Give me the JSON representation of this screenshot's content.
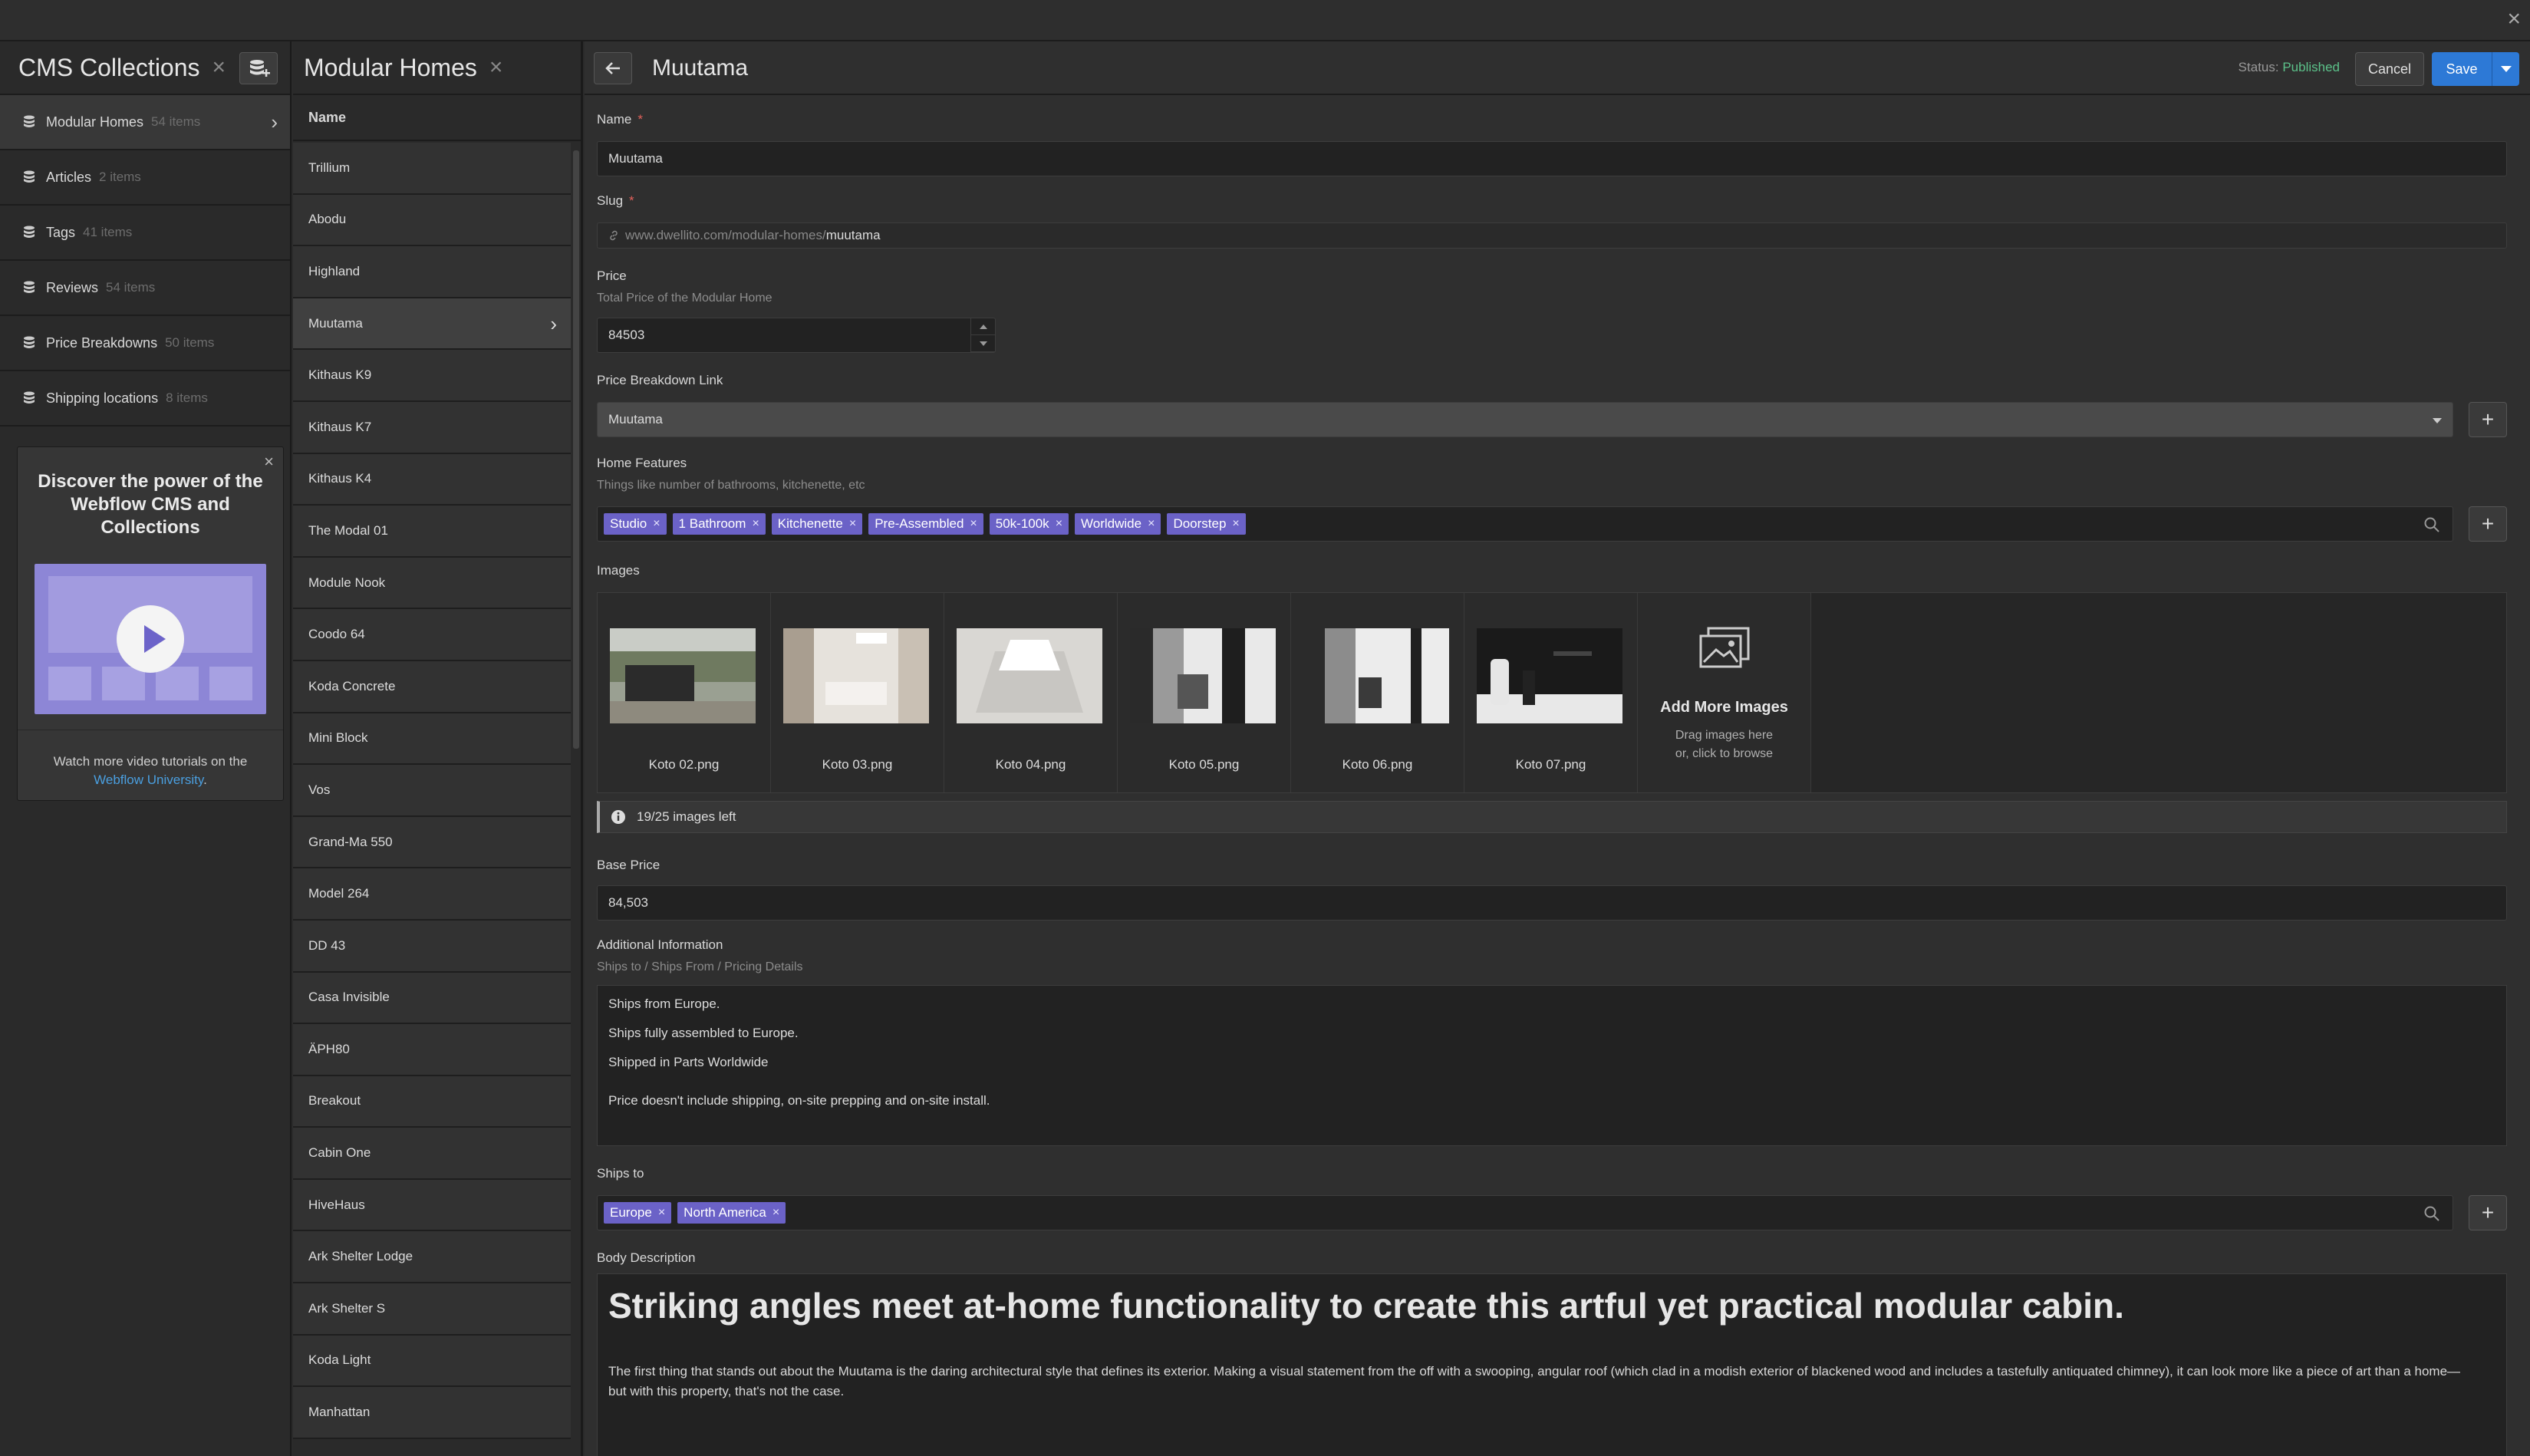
{
  "sidebar": {
    "title": "CMS Collections",
    "collections": [
      {
        "name": "Modular Homes",
        "count": "54 items"
      },
      {
        "name": "Articles",
        "count": "2 items"
      },
      {
        "name": "Tags",
        "count": "41 items"
      },
      {
        "name": "Reviews",
        "count": "54 items"
      },
      {
        "name": "Price Breakdowns",
        "count": "50 items"
      },
      {
        "name": "Shipping locations",
        "count": "8 items"
      }
    ],
    "promo": {
      "title": "Discover the power of the Webflow CMS and Collections",
      "footer_text": "Watch more video tutorials on the",
      "footer_link": "Webflow University",
      "footer_end": "."
    }
  },
  "list": {
    "title": "Modular Homes",
    "column_header": "Name",
    "items": [
      "Trillium",
      "Abodu",
      "Highland",
      "Muutama",
      "Kithaus K9",
      "Kithaus K7",
      "Kithaus K4",
      "The Modal 01",
      "Module Nook",
      "Coodo 64",
      "Koda Concrete",
      "Mini Block",
      "Vos",
      "Grand-Ma 550",
      "Model 264",
      "DD 43",
      "Casa Invisible",
      "ÄPH80",
      "Breakout",
      "Cabin One",
      "HiveHaus",
      "Ark Shelter Lodge",
      "Ark Shelter S",
      "Koda Light",
      "Manhattan"
    ]
  },
  "editor": {
    "title": "Muutama",
    "status_label": "Status:",
    "status_value": "Published",
    "cancel_label": "Cancel",
    "save_label": "Save",
    "name": {
      "label": "Name",
      "required": "*",
      "value": "Muutama"
    },
    "slug": {
      "label": "Slug",
      "required": "*",
      "prefix": "www.dwellito.com/modular-homes/",
      "value": "muutama"
    },
    "price": {
      "label": "Price",
      "help": "Total Price of the Modular Home",
      "value": "84503"
    },
    "price_breakdown": {
      "label": "Price Breakdown Link",
      "value": "Muutama"
    },
    "home_features": {
      "label": "Home Features",
      "help": "Things like number of bathrooms, kitchenette, etc",
      "tags": [
        "Studio",
        "1 Bathroom",
        "Kitchenette",
        "Pre-Assembled",
        "50k-100k",
        "Worldwide",
        "Doorstep"
      ]
    },
    "images": {
      "label": "Images",
      "files": [
        "Koto 02.png",
        "Koto 03.png",
        "Koto 04.png",
        "Koto 05.png",
        "Koto 06.png",
        "Koto 07.png"
      ],
      "add_title": "Add More Images",
      "add_hint_1": "Drag images here",
      "add_hint_2": "or, click to browse",
      "remaining": "19/25 images left"
    },
    "base_price": {
      "label": "Base Price",
      "value": "84,503"
    },
    "additional_info": {
      "label": "Additional Information",
      "help": "Ships to / Ships From / Pricing Details",
      "lines": [
        "Ships from Europe.",
        "Ships fully assembled to Europe.",
        "Shipped in Parts Worldwide",
        "Price doesn't include shipping, on-site prepping and on-site install."
      ]
    },
    "ships_to": {
      "label": "Ships to",
      "tags": [
        "Europe",
        "North America"
      ]
    },
    "body": {
      "label": "Body Description",
      "heading": "Striking angles meet at-home functionality to create this artful yet practical modular cabin.",
      "paragraph": "The first thing that stands out about the Muutama is the daring architectural style that defines its exterior. Making a visual statement from the off with a swooping, angular roof (which clad in a modish exterior of blackened wood and includes a tastefully antiquated chimney), it can look more like a piece of art than a home—but with this property, that's not the case."
    }
  },
  "colors": {
    "accent": "#2d79d6",
    "tag": "#6b62c7",
    "published": "#5cc28a"
  }
}
